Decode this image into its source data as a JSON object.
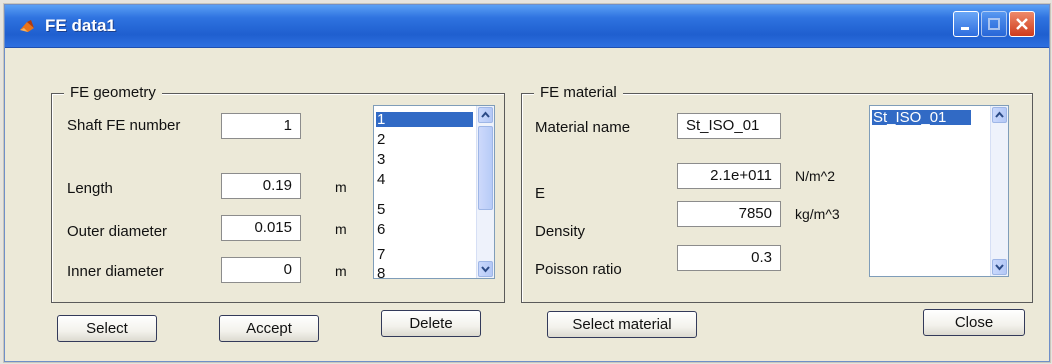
{
  "window": {
    "title": "FE data1"
  },
  "geometry": {
    "title": "FE geometry",
    "shaft_fe_number_label": "Shaft FE number",
    "shaft_fe_number_value": "1",
    "length_label": "Length",
    "length_value": "0.19",
    "length_unit": "m",
    "outer_diameter_label": "Outer diameter",
    "outer_diameter_value": "0.015",
    "outer_diameter_unit": "m",
    "inner_diameter_label": "Inner diameter",
    "inner_diameter_value": "0",
    "inner_diameter_unit": "m",
    "list_items": [
      "1",
      "2",
      "3",
      "4",
      "5",
      "6",
      "7",
      "8"
    ],
    "selected_index": 0
  },
  "material": {
    "title": "FE material",
    "material_name_label": "Material name",
    "material_name_value": "St_ISO_01",
    "e_label": "E",
    "e_value": "2.1e+011",
    "e_unit": "N/m^2",
    "density_label": "Density",
    "density_value": "7850",
    "density_unit": "kg/m^3",
    "poisson_label": "Poisson ratio",
    "poisson_value": "0.3",
    "list_items": [
      "St_ISO_01"
    ],
    "selected_index": 0
  },
  "buttons": {
    "select": "Select",
    "accept": "Accept",
    "delete": "Delete",
    "select_material": "Select material",
    "close": "Close"
  },
  "colors": {
    "selection": "#316ac5",
    "titlebar": "#2f73e0"
  }
}
